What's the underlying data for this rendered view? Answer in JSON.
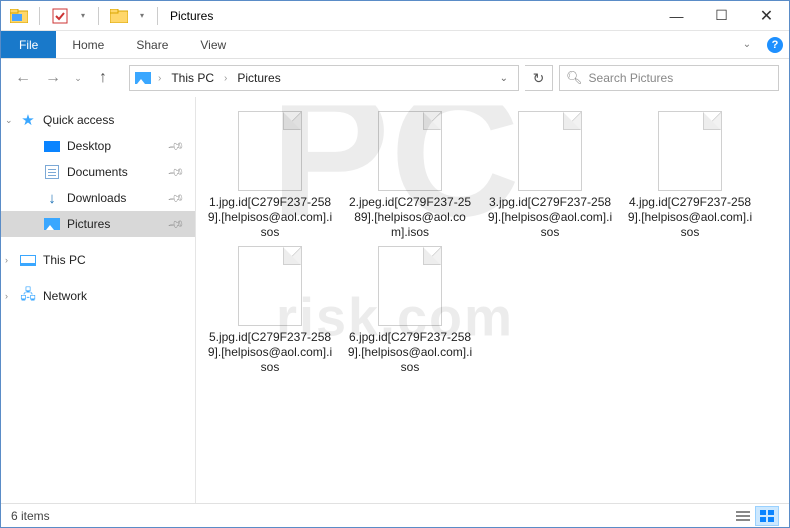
{
  "window": {
    "title": "Pictures",
    "minimize": "—",
    "maximize": "☐",
    "close": "✕"
  },
  "ribbon": {
    "file": "File",
    "tabs": [
      "Home",
      "Share",
      "View"
    ]
  },
  "nav": {
    "breadcrumb": [
      "This PC",
      "Pictures"
    ],
    "search_placeholder": "Search Pictures"
  },
  "sidebar": {
    "quick_access": "Quick access",
    "items": [
      {
        "label": "Desktop",
        "pinned": true
      },
      {
        "label": "Documents",
        "pinned": true
      },
      {
        "label": "Downloads",
        "pinned": true
      },
      {
        "label": "Pictures",
        "pinned": true,
        "selected": true
      }
    ],
    "this_pc": "This PC",
    "network": "Network"
  },
  "files": [
    {
      "name": "1.jpg.id[C279F237-2589].[helpisos@aol.com].isos"
    },
    {
      "name": "2.jpeg.id[C279F237-2589].[helpisos@aol.com].isos"
    },
    {
      "name": "3.jpg.id[C279F237-2589].[helpisos@aol.com].isos"
    },
    {
      "name": "4.jpg.id[C279F237-2589].[helpisos@aol.com].isos"
    },
    {
      "name": "5.jpg.id[C279F237-2589].[helpisos@aol.com].isos"
    },
    {
      "name": "6.jpg.id[C279F237-2589].[helpisos@aol.com].isos"
    }
  ],
  "status": {
    "count": "6 items"
  }
}
